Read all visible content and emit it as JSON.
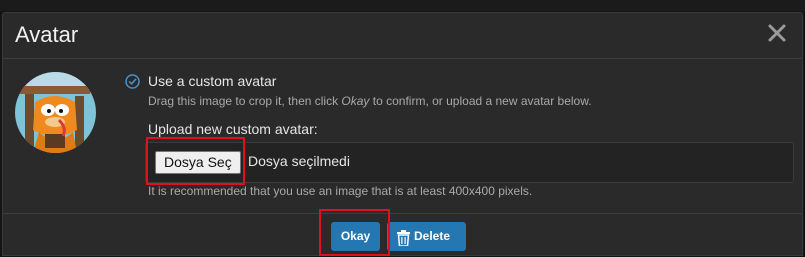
{
  "dialog": {
    "title": "Avatar",
    "close_icon": "close-icon"
  },
  "custom_avatar": {
    "radio_label": "Use a custom avatar",
    "description_pre": "Drag this image to crop it, then click ",
    "description_okay": "Okay",
    "description_post": " to confirm, or upload a new avatar below.",
    "upload_label": "Upload new custom avatar:",
    "file_button": "Dosya Seç",
    "file_status": "Dosya seçilmedi",
    "hint": "It is recommended that you use an image that is at least 400x400 pixels."
  },
  "footer": {
    "okay_label": "Okay",
    "delete_label": "Delete",
    "delete_icon": "trash-icon"
  },
  "colors": {
    "primary_button": "#2577b1",
    "highlight": "#e01020",
    "check": "#4a90c8"
  }
}
